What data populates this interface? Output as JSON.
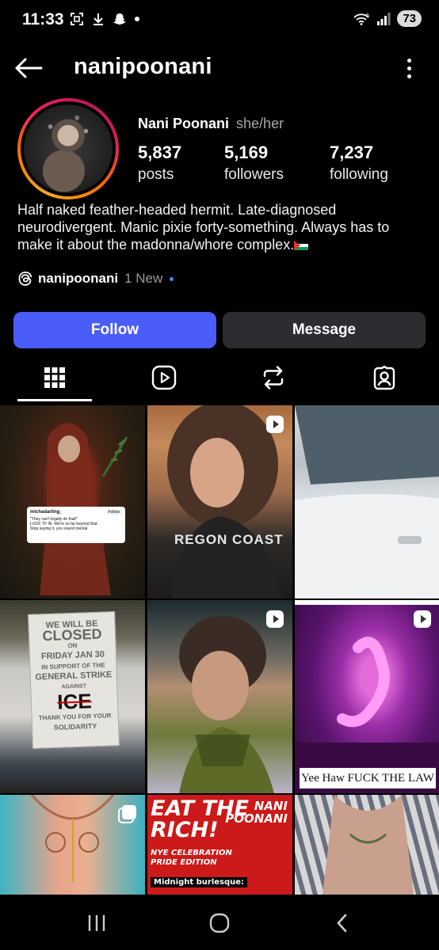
{
  "status_bar": {
    "time": "11:33",
    "battery": "73",
    "network": "5"
  },
  "nav": {
    "title": "nanipoonani"
  },
  "profile": {
    "display_name": "Nani Poonani",
    "pronouns": "she/her",
    "stats": [
      {
        "value": "5,837",
        "label": "posts"
      },
      {
        "value": "5,169",
        "label": "followers"
      },
      {
        "value": "7,237",
        "label": "following"
      }
    ],
    "bio": "Half naked feather-headed hermit. Late-diagnosed neurodivergent. Manic pixie forty-something. Always has to make it about the madonna/whore complex.",
    "threads": {
      "name": "nanipoonani",
      "new_label": "1 New"
    }
  },
  "actions": {
    "follow": "Follow",
    "message": "Message",
    "follow_color": "#4a5df9"
  },
  "tabs": [
    "grid-icon",
    "reels-icon",
    "reposts-icon",
    "tagged-icon"
  ],
  "grid": {
    "post1": {
      "username": "michadarling_",
      "follow": "Follow",
      "line1": "\"They can't legally do that!\"",
      "line2": "LOCK TF IN. We're so far beyond that.",
      "line3": "Stop saying it, you sound mental."
    },
    "post2_text": "REGON COAST",
    "post4": {
      "line1": "WE WILL BE",
      "line2": "CLOSED",
      "line3": "ON",
      "line4": "FRIDAY JAN 30",
      "line5": "IN SUPPORT OF THE",
      "line6": "GENERAL STRIKE",
      "line7": "AGAINST",
      "line8": "ICE",
      "line9": "THANK YOU FOR YOUR",
      "line10": "SOLIDARITY"
    },
    "post6_caption": "Yee Haw FUCK THE LAW",
    "post8": {
      "title_line1": "EAT THE",
      "title_line2": "RICH!",
      "name_line1": "NANI",
      "name_line2": "POONANI",
      "sub_line1": "NYE CELEBRATION",
      "sub_line2": "PRIDE EDITION",
      "tag": "Midnight burlesque:"
    }
  }
}
